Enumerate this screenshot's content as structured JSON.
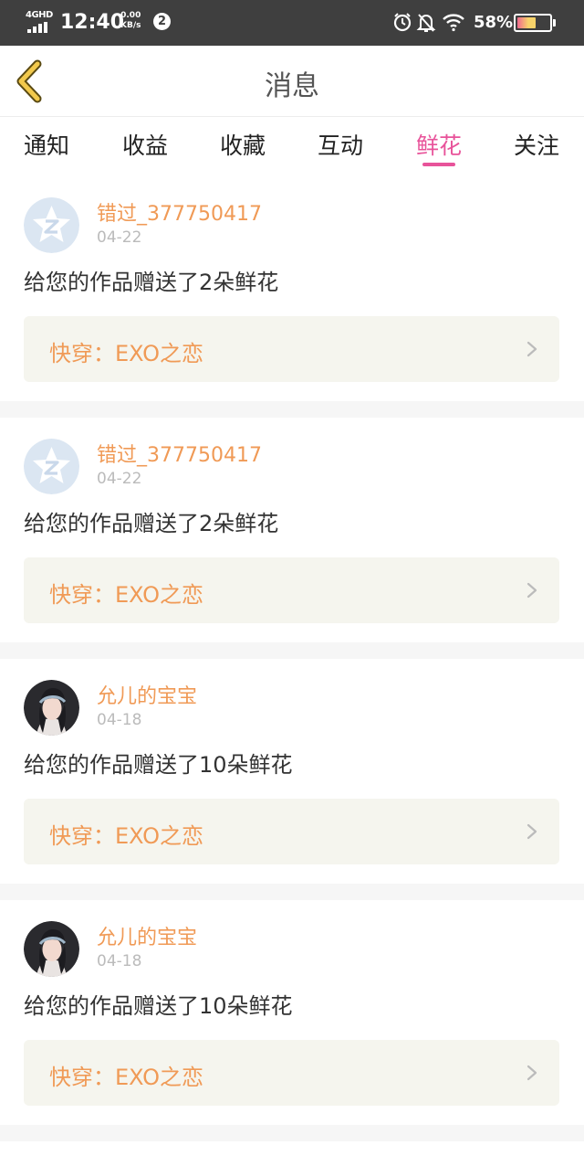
{
  "status_bar": {
    "network": "4GHD",
    "time": "12:40",
    "speed_value": "0.00",
    "speed_unit": "KB/s",
    "notification_count": "2",
    "battery_percent": "58%",
    "battery_level": 0.58,
    "icons": [
      "signal-icon",
      "alarm-icon",
      "bell-muted-icon",
      "wifi-icon",
      "battery-icon"
    ]
  },
  "header": {
    "title": "消息",
    "back_icon": "chevron-left-icon",
    "accent_color": "#f2c94c"
  },
  "tabs": {
    "items": [
      {
        "label": "通知",
        "active": false
      },
      {
        "label": "收益",
        "active": false
      },
      {
        "label": "收藏",
        "active": false
      },
      {
        "label": "互动",
        "active": false
      },
      {
        "label": "鲜花",
        "active": true
      },
      {
        "label": "关注",
        "active": false
      }
    ],
    "active_color": "#e8539a"
  },
  "messages": [
    {
      "username": "错过_377750417",
      "date": "04-22",
      "avatar": "default-avatar-icon",
      "text": "给您的作品赠送了2朵鲜花",
      "book_title": "快穿：EXO之恋"
    },
    {
      "username": "错过_377750417",
      "date": "04-22",
      "avatar": "default-avatar-icon",
      "text": "给您的作品赠送了2朵鲜花",
      "book_title": "快穿：EXO之恋"
    },
    {
      "username": "允儿的宝宝",
      "date": "04-18",
      "avatar": "photo-avatar",
      "text": "给您的作品赠送了10朵鲜花",
      "book_title": "快穿：EXO之恋"
    },
    {
      "username": "允儿的宝宝",
      "date": "04-18",
      "avatar": "photo-avatar",
      "text": "给您的作品赠送了10朵鲜花",
      "book_title": "快穿：EXO之恋"
    }
  ],
  "colors": {
    "username": "#f09a56",
    "book_card_bg": "#f5f5ee",
    "separator": "#f6f6f6"
  }
}
